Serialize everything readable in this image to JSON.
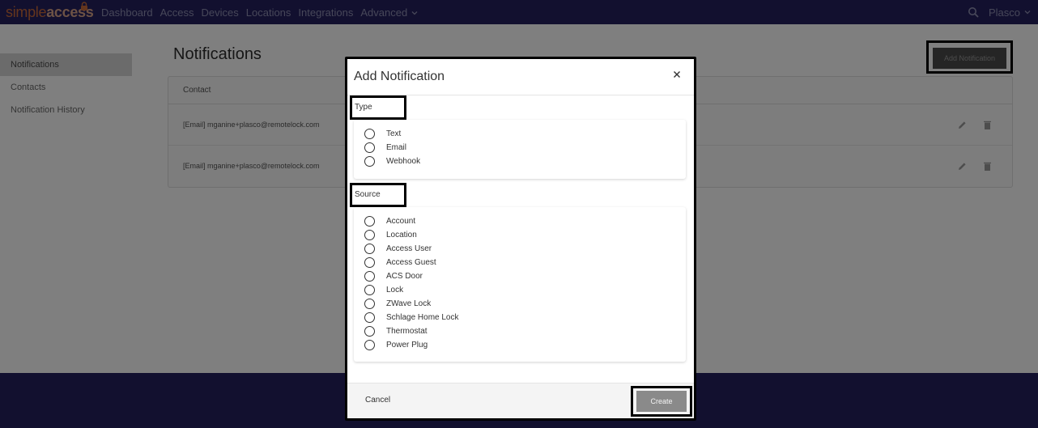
{
  "brand": {
    "logo_prefix": "simple",
    "logo_suffix": "access",
    "logo_icon": "lock-icon"
  },
  "nav": {
    "items": [
      "Dashboard",
      "Access",
      "Devices",
      "Locations",
      "Integrations",
      "Advanced"
    ],
    "search_icon": "search-icon",
    "user_label": "Plasco"
  },
  "sidebar": {
    "items": [
      {
        "label": "Notifications",
        "active": true
      },
      {
        "label": "Contacts",
        "active": false
      },
      {
        "label": "Notification History",
        "active": false
      }
    ]
  },
  "page": {
    "title": "Notifications",
    "add_button_label": "Add Notification"
  },
  "table": {
    "header_contact": "Contact",
    "rows": [
      {
        "contact": "[Email] mganine+plasco@remotelock.com"
      },
      {
        "contact": "[Email] mganine+plasco@remotelock.com"
      }
    ]
  },
  "modal": {
    "title": "Add Notification",
    "type_label": "Type",
    "type_options": [
      "Text",
      "Email",
      "Webhook"
    ],
    "source_label": "Source",
    "source_options": [
      "Account",
      "Location",
      "Access User",
      "Access Guest",
      "ACS Door",
      "Lock",
      "ZWave Lock",
      "Schlage Home Lock",
      "Thermostat",
      "Power Plug"
    ],
    "cancel_label": "Cancel",
    "create_label": "Create"
  },
  "colors": {
    "nav_bg": "#25205f",
    "logo_accent": "#c96a3a",
    "button_dark": "#4a4a4a",
    "create_button": "#8a8a8a"
  }
}
